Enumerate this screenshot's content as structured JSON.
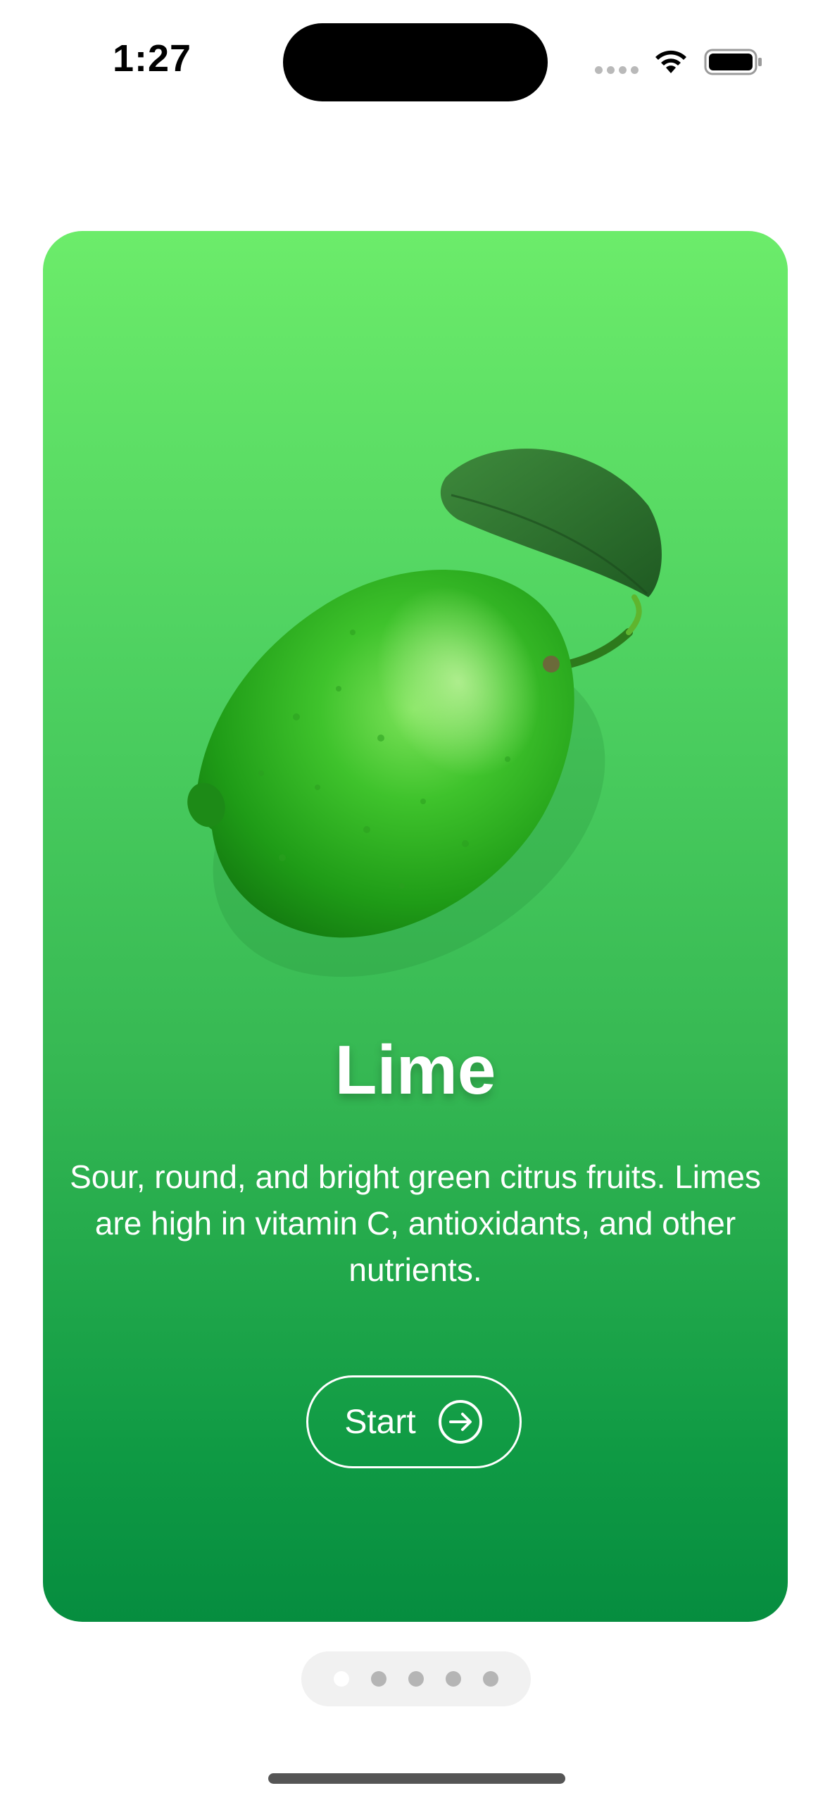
{
  "status_bar": {
    "time": "1:27"
  },
  "card": {
    "title": "Lime",
    "description": "Sour, round, and bright green citrus fruits. Limes are high in vitamin C, antioxidants, and other nutrients.",
    "start_label": "Start",
    "start_icon": "arrow-right-circle-icon",
    "gradient_top": "#6cec6a",
    "gradient_bottom": "#068d3f"
  },
  "page_indicator": {
    "page_count": 5,
    "current_page": 1
  }
}
